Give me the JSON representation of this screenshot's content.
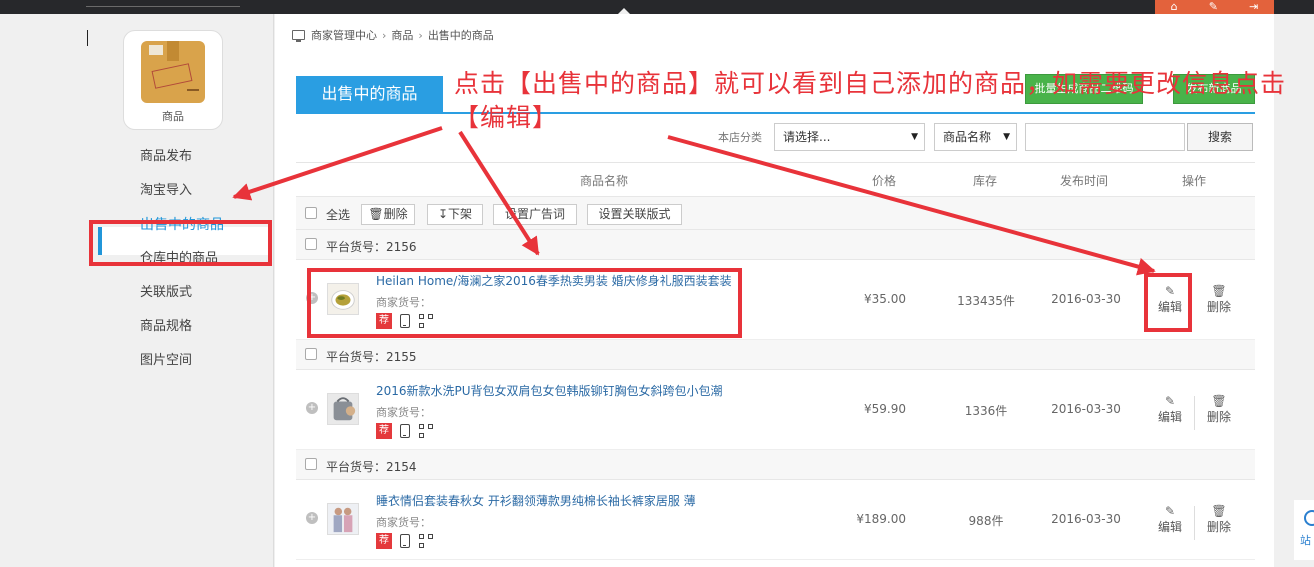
{
  "topbar": {
    "icons": [
      "home-icon",
      "wrench-icon",
      "logout-icon"
    ]
  },
  "sidebar": {
    "module_label": "商品",
    "nav": [
      {
        "label": "商品发布"
      },
      {
        "label": "淘宝导入"
      },
      {
        "label": "出售中的商品",
        "active": true
      },
      {
        "label": "仓库中的商品"
      },
      {
        "label": "关联版式"
      },
      {
        "label": "商品规格"
      },
      {
        "label": "图片空间"
      }
    ]
  },
  "breadcrumb": [
    "商家管理中心",
    "商品",
    "出售中的商品"
  ],
  "tab_title": "出售中的商品",
  "header_buttons": [
    "批量生成商品二维码",
    "发布新商品"
  ],
  "filter": {
    "category_label": "本店分类",
    "category_select": "请选择...",
    "field_select": "商品名称",
    "search_button": "搜索"
  },
  "table": {
    "columns": {
      "name": "商品名称",
      "price": "价格",
      "stock": "库存",
      "date": "发布时间",
      "ops": "操作"
    },
    "toolbar": {
      "select_all": "全选",
      "delete": "删除",
      "delist": "下架",
      "set_ad": "设置广告词",
      "set_template": "设置关联版式"
    },
    "groups": [
      {
        "platform_no": "平台货号：2156",
        "product": {
          "name": "Heilan Home/海澜之家2016春季热卖男装 婚庆修身礼服西装套装",
          "sku_label": "商家货号：",
          "badge": "荐",
          "price": "¥35.00",
          "stock": "133435件",
          "date": "2016-03-30",
          "edit": "编辑",
          "delete": "删除"
        }
      },
      {
        "platform_no": "平台货号：2155",
        "product": {
          "name": "2016新款水洗PU背包女双肩包女包韩版铆钉胸包女斜跨包小包潮",
          "sku_label": "商家货号：",
          "badge": "荐",
          "price": "¥59.90",
          "stock": "1336件",
          "date": "2016-03-30",
          "edit": "编辑",
          "delete": "删除"
        }
      },
      {
        "platform_no": "平台货号：2154",
        "product": {
          "name": "睡衣情侣套装春秋女 开衫翻领薄款男纯棉长袖长裤家居服 薄",
          "sku_label": "商家货号：",
          "badge": "荐",
          "price": "¥189.00",
          "stock": "988件",
          "date": "2016-03-30",
          "edit": "编辑",
          "delete": "删除"
        }
      }
    ]
  },
  "annotation": "点击【出售中的商品】就可以看到自己添加的商品，如需要更改信息点击【编辑】",
  "edge_widget_text": "站",
  "colors": {
    "accent": "#2a9ee2",
    "green": "#49b34a",
    "annotation_red": "#e8333a",
    "topbar": "#27282b",
    "topbar_accent": "#e3623c"
  }
}
